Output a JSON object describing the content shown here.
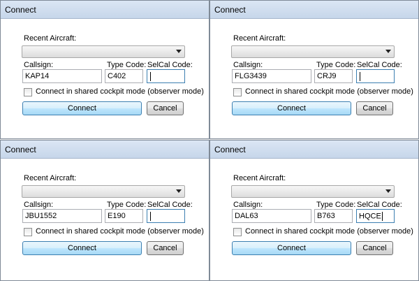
{
  "dialogs": [
    {
      "title": "Connect",
      "recent_aircraft_label": "Recent Aircraft:",
      "callsign_label": "Callsign:",
      "type_code_label": "Type Code:",
      "selcal_label": "SelCal Code:",
      "callsign": "KAP14",
      "type_code": "C402",
      "selcal": "",
      "observer_label": "Connect in shared cockpit mode (observer mode)",
      "connect_label": "Connect",
      "cancel_label": "Cancel"
    },
    {
      "title": "Connect",
      "recent_aircraft_label": "Recent Aircraft:",
      "callsign_label": "Callsign:",
      "type_code_label": "Type Code:",
      "selcal_label": "SelCal Code:",
      "callsign": "FLG3439",
      "type_code": "CRJ9",
      "selcal": "",
      "observer_label": "Connect in shared cockpit mode (observer mode)",
      "connect_label": "Connect",
      "cancel_label": "Cancel"
    },
    {
      "title": "Connect",
      "recent_aircraft_label": "Recent Aircraft:",
      "callsign_label": "Callsign:",
      "type_code_label": "Type Code:",
      "selcal_label": "SelCal Code:",
      "callsign": "JBU1552",
      "type_code": "E190",
      "selcal": "",
      "observer_label": "Connect in shared cockpit mode (observer mode)",
      "connect_label": "Connect",
      "cancel_label": "Cancel"
    },
    {
      "title": "Connect",
      "recent_aircraft_label": "Recent Aircraft:",
      "callsign_label": "Callsign:",
      "type_code_label": "Type Code:",
      "selcal_label": "SelCal Code:",
      "callsign": "DAL63",
      "type_code": "B763",
      "selcal": "HQCE",
      "observer_label": "Connect in shared cockpit mode (observer mode)",
      "connect_label": "Connect",
      "cancel_label": "Cancel"
    }
  ]
}
